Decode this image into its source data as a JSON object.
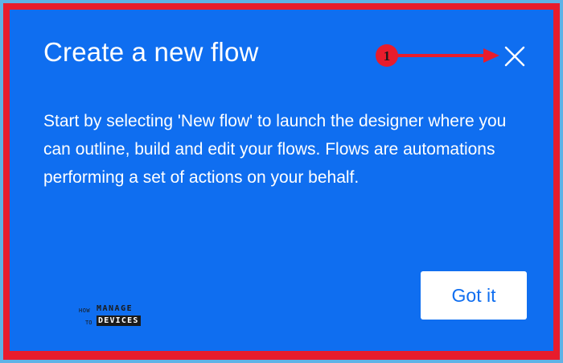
{
  "dialog": {
    "title": "Create a new flow",
    "body": "Start by selecting 'New flow' to launch the designer where you can outline, build and edit your flows. Flows are automations performing a set of actions on your behalf.",
    "primary_button_label": "Got it",
    "close_icon": "close-icon"
  },
  "annotation": {
    "marker_number": "1",
    "color": "#e81c2c"
  },
  "watermark": {
    "how": "HOW",
    "to": "TO",
    "manage": "MANAGE",
    "devices": "DEVICES"
  },
  "colors": {
    "dialog_background": "#0f6ef0",
    "frame_border": "#e81c2c",
    "page_background": "#5fb2e6",
    "button_background": "#ffffff",
    "button_text": "#0f6ef0"
  }
}
